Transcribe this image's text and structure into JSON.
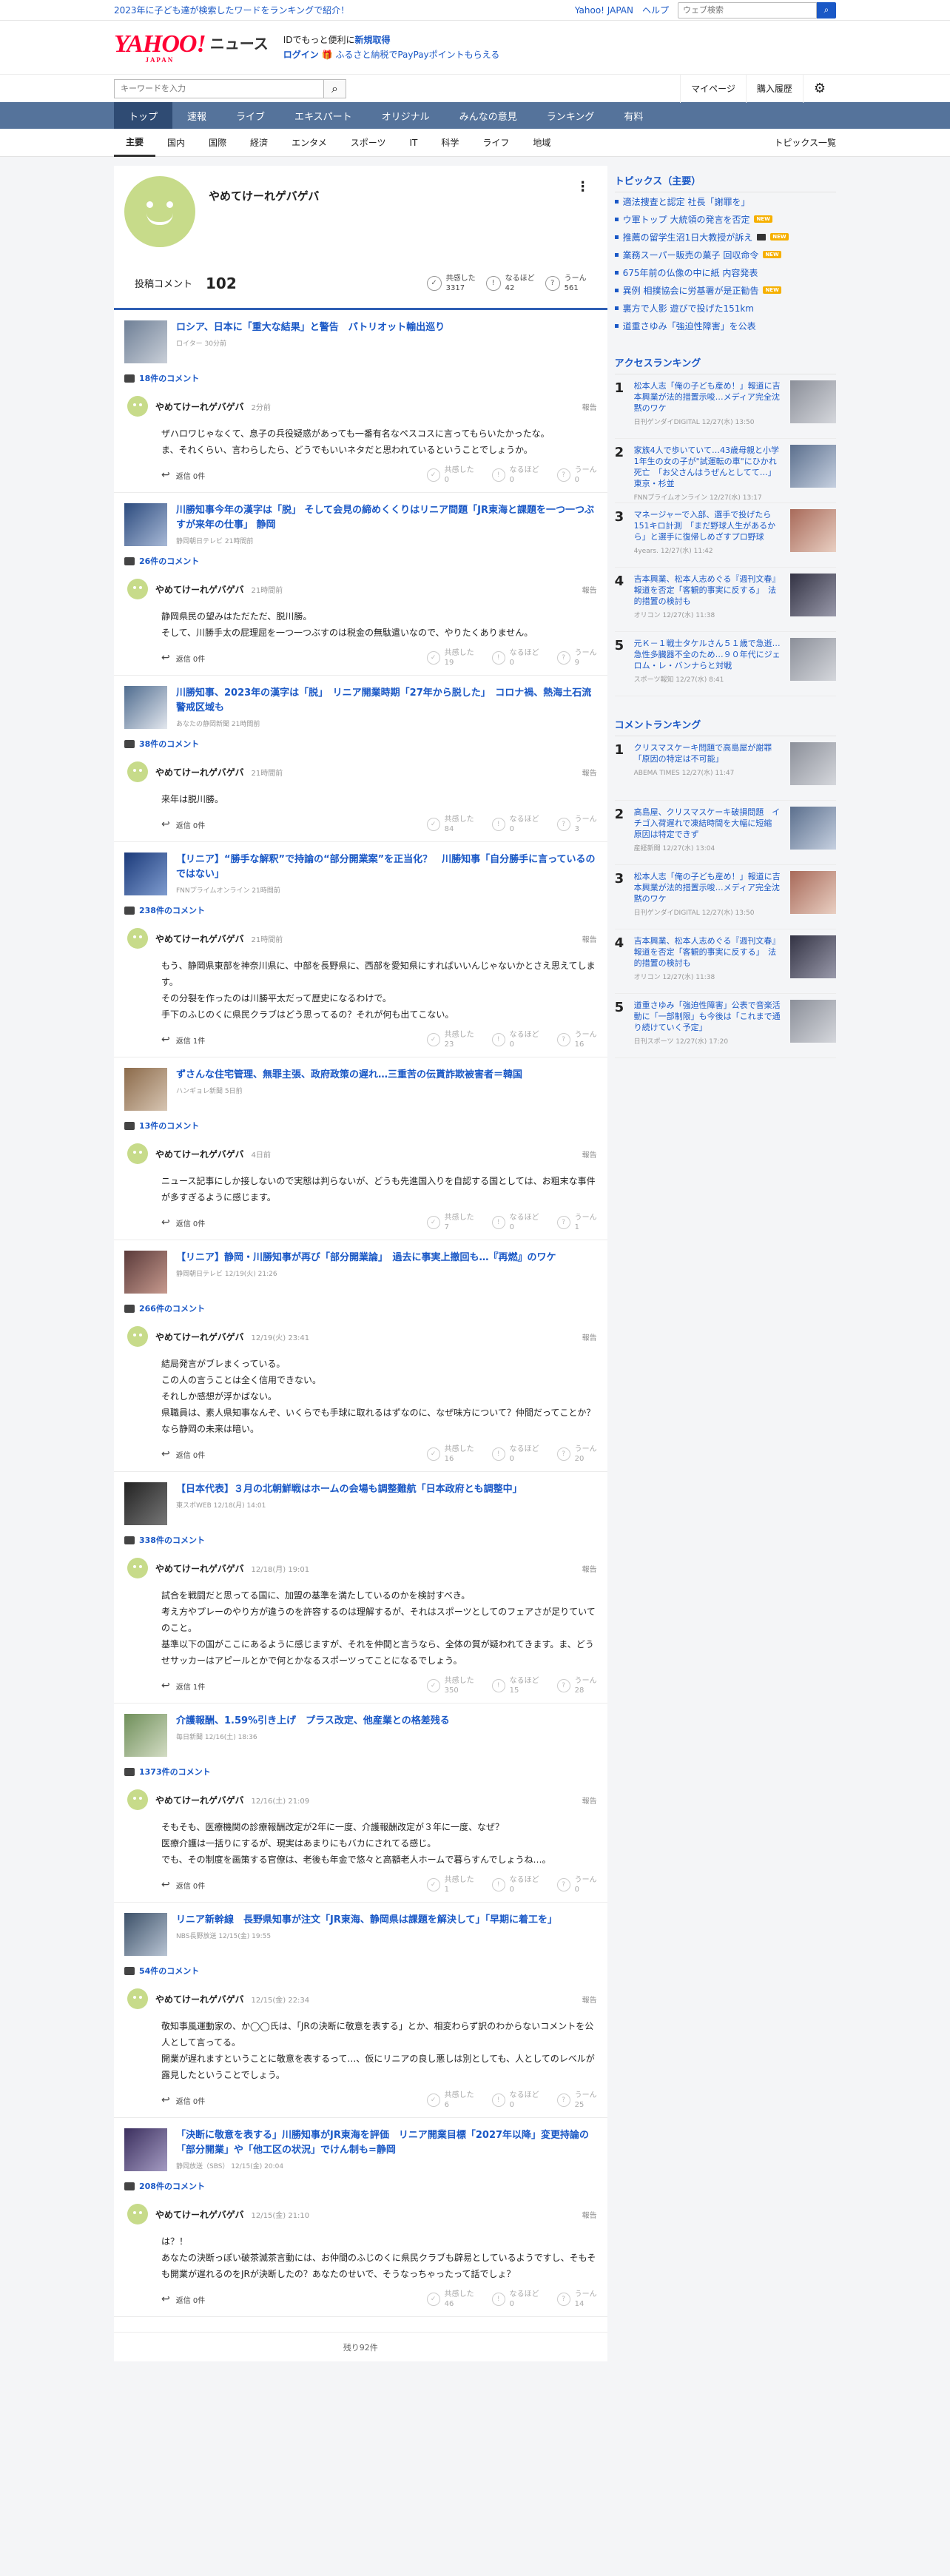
{
  "topbar": {
    "promo": "2023年に子ども達が検索したワードをランキングで紹介！",
    "links": [
      "Yahoo! JAPAN",
      "ヘルプ"
    ],
    "search_placeholder": "ウェブ検索"
  },
  "masthead": {
    "logo": "YAHOO!",
    "logo_sub": "JAPAN",
    "service": "ニュース",
    "line1_a": "IDでもっと便利に",
    "line1_b": "新規取得",
    "line2_a": "ログイン",
    "line2_b": "ふるさと納税でPayPayポイントもらえる"
  },
  "subsearch": {
    "placeholder": "キーワードを入力",
    "mypage": "マイページ",
    "history": "購入履歴"
  },
  "nav_main": [
    "トップ",
    "速報",
    "ライブ",
    "エキスパート",
    "オリジナル",
    "みんなの意見",
    "ランキング",
    "有料"
  ],
  "nav_sub": [
    "主要",
    "国内",
    "国際",
    "経済",
    "エンタメ",
    "スポーツ",
    "IT",
    "科学",
    "ライフ",
    "地域"
  ],
  "nav_sub_list": "トピックス一覧",
  "profile": {
    "name": "やめてけーれゲバゲバ",
    "more": "⋮",
    "post_label": "投稿コメント",
    "post_count": "102",
    "reactions": [
      {
        "icon": "✓",
        "label": "共感した",
        "value": "3317"
      },
      {
        "icon": "!",
        "label": "なるほど",
        "value": "42"
      },
      {
        "icon": "?",
        "label": "うーん",
        "value": "561"
      }
    ]
  },
  "reply_labels": {
    "report": "報告",
    "kyokan": "共感した",
    "naruhodo": "なるほど",
    "un": "うーん"
  },
  "blocks": [
    {
      "title": "ロシア、日本に「重大な結果」と警告　パトリオット輸出巡り",
      "src": "ロイター 30分前",
      "count": "18件のコメント",
      "time": "2分前",
      "body": "ザハロワじゃなくて、息子の兵役疑惑があっても一番有名なペスコスに言ってもらいたかったな。\nま、それくらい、言わらしたら、どうでもいいネタだと思われているということでしょうか。",
      "reply": "返信 0件",
      "r": [
        "0",
        "0",
        "0"
      ]
    },
    {
      "title": "川勝知事今年の漢字は「脱」 そして会見の締めくくりはリニア問題「JR東海と課題を一つ一つぶすが来年の仕事」 静岡",
      "src": "静岡朝日テレビ 21時間前",
      "count": "26件のコメント",
      "time": "21時間前",
      "body": "静岡県民の望みはただただ、脱川勝。\nそして、川勝手太の屁理屈を一つ一つぶすのは税金の無駄遣いなので、やりたくありません。",
      "reply": "返信 0件",
      "r": [
        "19",
        "0",
        "9"
      ]
    },
    {
      "title": "川勝知事、2023年の漢字は「脱」　リニア開業時期「27年から脱した」　コロナ禍、熱海土石流警戒区域も",
      "src": "あなたの静岡新聞 21時間前",
      "count": "38件のコメント",
      "time": "21時間前",
      "body": "来年は脱川勝。",
      "reply": "返信 0件",
      "r": [
        "84",
        "0",
        "3"
      ]
    },
    {
      "title": "【リニア】“勝手な解釈”で持論の“部分開業案”を正当化？　川勝知事「自分勝手に言っているのではない」",
      "src": "FNNプライムオンライン 21時間前",
      "count": "238件のコメント",
      "time": "21時間前",
      "body": "もう、静岡県東部を神奈川県に、中部を長野県に、西部を愛知県にすればいいんじゃないかとさえ思えてします。\nその分裂を作ったのは川勝平太だって歴史になるわけで。\n手下のふじのくに県民クラブはどう思ってるの？それが何も出てこない。",
      "reply": "返信 1件",
      "r": [
        "23",
        "0",
        "16"
      ]
    },
    {
      "title": "ずさんな住宅管理、無罪主張、政府政策の遅れ…三重苦の伝貰詐欺被害者＝韓国",
      "src": "ハンギョレ新聞 5日前",
      "count": "13件のコメント",
      "time": "4日前",
      "body": "ニュース記事にしか接しないので実態は判らないが、どうも先進国入りを自認する国としては、お粗末な事件が多すぎるように感じます。",
      "reply": "返信 0件",
      "r": [
        "7",
        "0",
        "1"
      ]
    },
    {
      "title": "【リニア】静岡・川勝知事が再び「部分開業論」　過去に事実上撤回も…『再燃』のワケ",
      "src": "静岡朝日テレビ 12/19(火) 21:26",
      "count": "266件のコメント",
      "time": "12/19(火) 23:41",
      "body": "結局発言がブレまくっている。\nこの人の言うことは全く信用できない。\nそれしか感想が浮かばない。\n県職員は、素人県知事なんぞ、いくらでも手球に取れるはずなのに、なぜ味方について？仲間だってことか？なら静岡の未来は暗い。",
      "reply": "返信 0件",
      "r": [
        "16",
        "0",
        "20"
      ]
    },
    {
      "title": "【日本代表】３月の北朝鮮戦はホームの会場も調整難航「日本政府とも調整中」",
      "src": "東スポWEB 12/18(月) 14:01",
      "count": "338件のコメント",
      "time": "12/18(月) 19:01",
      "body": "試合を戦闘だと思ってる国に、加盟の基準を満たしているのかを検討すべき。\n考え方やプレーのやり方が違うのを許容するのは理解するが、それはスポーツとしてのフェアさが足りていてのこと。\n基準以下の国がここにあるように感じますが、それを仲間と言うなら、全体の質が疑われてきます。ま、どうせサッカーはアピールとかで何とかなるスポーツってことになるでしょう。",
      "reply": "返信 1件",
      "r": [
        "350",
        "15",
        "28"
      ]
    },
    {
      "title": "介護報酬、1.59%引き上げ　プラス改定、他産業との格差残る",
      "src": "毎日新聞 12/16(土) 18:36",
      "count": "1373件のコメント",
      "time": "12/16(土) 21:09",
      "body": "そもそも、医療機関の診療報酬改定が2年に一度、介護報酬改定が３年に一度、なぜ？\n医療介護は一括りにするが、現実はあまりにもバカにされてる感じ。\nでも、その制度を画策する官僚は、老後も年金で悠々と高額老人ホームで暮らすんでしょうね…。",
      "reply": "返信 0件",
      "r": [
        "1",
        "0",
        "0"
      ]
    },
    {
      "title": "リニア新幹線　長野県知事が注文「JR東海、静岡県は課題を解決して」「早期に着工を」",
      "src": "NBS長野放送 12/15(金) 19:55",
      "count": "54件のコメント",
      "time": "12/15(金) 22:34",
      "body": "敬知事風運動家の、か◯◯氏は、「JRの決断に敬意を表する」とか、相変わらず訳のわからないコメントを公人として言ってる。\n開業が遅れますということに敬意を表するって…、仮にリニアの良し悪しは別としても、人としてのレベルが露見したということでしょう。",
      "reply": "返信 0件",
      "r": [
        "6",
        "0",
        "25"
      ]
    },
    {
      "title": "「決断に敬意を表する」川勝知事がJR東海を評価　リニア開業目標「2027年以降」変更持論の「部分開業」や「他工区の状況」でけん制も=静岡",
      "src": "静岡放送（SBS） 12/15(金) 20:04",
      "count": "208件のコメント",
      "time": "12/15(金) 21:10",
      "body": "は？！\nあなたの決断っぽい破茶滅茶言動には、お仲間のふじのくに県民クラブも辟易としているようですし、そもそも開業が遅れるのをJRが決断したの？あなたのせいで、そうなっちゃったって話でしょ？",
      "reply": "返信 0件",
      "r": [
        "46",
        "0",
        "14"
      ]
    }
  ],
  "remaining": "残り92件",
  "side": {
    "topics_title": "トピックス（主要）",
    "topics": [
      {
        "t": "適法捜査と認定 社長「謝罪を」",
        "tag": ""
      },
      {
        "t": "ウ軍トップ 大統領の発言を否定",
        "tag": "NEW"
      },
      {
        "t": "推薦の留学生沼1日大教授が訴え",
        "tag": "NEW"
      },
      {
        "t": "業務スーパー販売の菓子 回収命令",
        "tag": "NEW"
      },
      {
        "t": "675年前の仏像の中に紙 内容発表",
        "tag": ""
      },
      {
        "t": "異例 相撲協会に労基署が是正勧告",
        "tag": "NEW"
      },
      {
        "t": "裏方で人影 遊びで投げた151km",
        "tag": ""
      },
      {
        "t": "道重さゆみ「強迫性障害」を公表",
        "tag": ""
      }
    ],
    "access_title": "アクセスランキング",
    "access": [
      {
        "no": "1",
        "t": "松本人志「俺の子ども産め！」報道に吉本興業が法的措置示唆…メディア完全沈黙のワケ",
        "s": "日刊ゲンダイDIGITAL 12/27(水) 13:50"
      },
      {
        "no": "2",
        "t": "家族4人で歩いていて…43歳母親と小学1年生の女の子が\"試運転の車\"にひかれ死亡　「お父さんはうぜんとしてて…」　東京・杉並",
        "s": "FNNプライムオンライン 12/27(水) 13:17"
      },
      {
        "no": "3",
        "t": "マネージャーで入部、選手で投げたら151キロ計測　「まだ野球人生があるから」と選手に復帰しめざすプロ野球",
        "s": "4years. 12/27(水) 11:42"
      },
      {
        "no": "4",
        "t": "吉本興業、松本人志めぐる『週刊文春』報道を否定「客観的事実に反する」　法的措置の検討も",
        "s": "オリコン 12/27(水) 11:38"
      },
      {
        "no": "5",
        "t": "元Ｋ－１戦士タケルさん５１歳で急逝…急性多臓器不全のため…９０年代にジェロム・レ・バンナらと対戦",
        "s": "スポーツ報知 12/27(水) 8:41"
      }
    ],
    "comment_title": "コメントランキング",
    "comments": [
      {
        "no": "1",
        "t": "クリスマスケーキ問題で高島屋が謝罪「原因の特定は不可能」",
        "s": "ABEMA TIMES 12/27(水) 11:47"
      },
      {
        "no": "2",
        "t": "高島屋、クリスマスケーキ破損問題　イチゴ入荷遅れで凍結時間を大幅に短縮　原因は特定できず",
        "s": "産経新聞 12/27(水) 13:04"
      },
      {
        "no": "3",
        "t": "松本人志「俺の子ども産め！」報道に吉本興業が法的措置示唆…メディア完全沈黙のワケ",
        "s": "日刊ゲンダイDIGITAL 12/27(水) 13:50"
      },
      {
        "no": "4",
        "t": "吉本興業、松本人志めぐる『週刊文春』報道を否定「客観的事実に反する」　法的措置の検討も",
        "s": "オリコン 12/27(水) 11:38"
      },
      {
        "no": "5",
        "t": "道重さゆみ「強迫性障害」公表で音楽活動に「一部制限」も今後は「これまで通り続けていく予定」",
        "s": "日刊スポーツ 12/27(水) 17:20"
      }
    ]
  },
  "colors": {
    "brand_red": "#ff0033",
    "link_blue": "#1a58c6",
    "nav_bg": "#55739b",
    "nav_active": "#2f4b73"
  }
}
